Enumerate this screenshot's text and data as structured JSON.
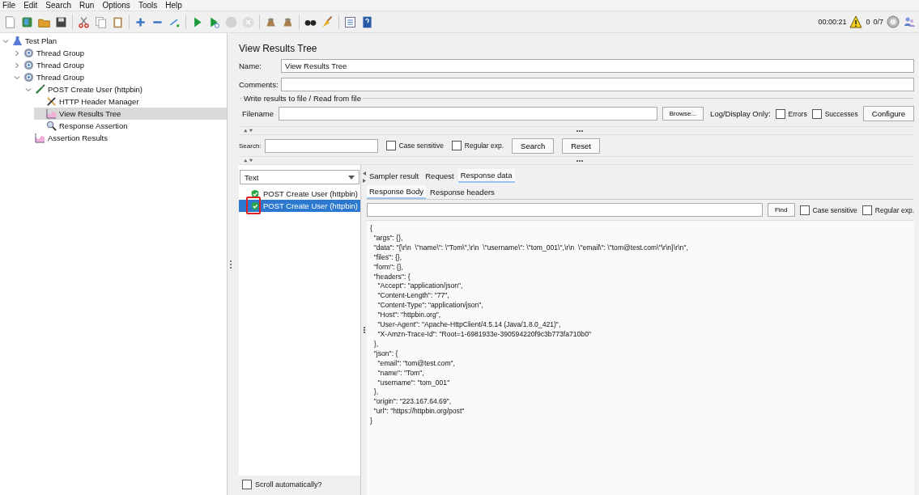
{
  "menu": [
    {
      "label": "File"
    },
    {
      "label": "Edit"
    },
    {
      "label": "Search"
    },
    {
      "label": "Run"
    },
    {
      "label": "Options"
    },
    {
      "label": "Tools"
    },
    {
      "label": "Help"
    }
  ],
  "toolbar": [
    {
      "kind": "new",
      "disabled": false
    },
    {
      "kind": "templates",
      "disabled": false
    },
    {
      "kind": "open",
      "disabled": false
    },
    {
      "kind": "save",
      "disabled": false
    },
    {
      "kind": "sep"
    },
    {
      "kind": "cut",
      "disabled": false
    },
    {
      "kind": "copy",
      "disabled": false
    },
    {
      "kind": "paste",
      "disabled": false
    },
    {
      "kind": "sep"
    },
    {
      "kind": "expand",
      "disabled": false
    },
    {
      "kind": "collapse",
      "disabled": false
    },
    {
      "kind": "toggle",
      "disabled": false
    },
    {
      "kind": "sep"
    },
    {
      "kind": "start",
      "disabled": false
    },
    {
      "kind": "start-no-pause",
      "disabled": false
    },
    {
      "kind": "stop",
      "disabled": true
    },
    {
      "kind": "shutdown",
      "disabled": true
    },
    {
      "kind": "sep"
    },
    {
      "kind": "clear",
      "disabled": false
    },
    {
      "kind": "clear-all",
      "disabled": false
    },
    {
      "kind": "sep"
    },
    {
      "kind": "search",
      "disabled": false
    },
    {
      "kind": "reset-search",
      "disabled": false
    },
    {
      "kind": "sep"
    },
    {
      "kind": "functions",
      "disabled": false
    },
    {
      "kind": "help",
      "disabled": false
    }
  ],
  "status": {
    "elapsed": "00:00:21",
    "warnings": "0",
    "threads": "0/7"
  },
  "tree": [
    {
      "label": "Test Plan",
      "kind": "plan",
      "expanded": true,
      "selected": false,
      "children": [
        {
          "label": "Thread Group",
          "kind": "thread",
          "expanded": false,
          "selected": false
        },
        {
          "label": "Thread Group",
          "kind": "thread",
          "expanded": false,
          "selected": false
        },
        {
          "label": "Thread Group",
          "kind": "thread",
          "expanded": true,
          "selected": false,
          "children": [
            {
              "label": "POST Create User (httpbin)",
              "kind": "sampler",
              "expanded": true,
              "selected": false,
              "children": [
                {
                  "label": "HTTP Header Manager",
                  "kind": "config",
                  "selected": false
                },
                {
                  "label": "View Results Tree",
                  "kind": "listener",
                  "selected": true
                },
                {
                  "label": "Response Assertion",
                  "kind": "assertion",
                  "selected": false
                }
              ]
            },
            {
              "label": "Assertion Results",
              "kind": "listener",
              "selected": false
            }
          ]
        }
      ]
    }
  ],
  "panel": {
    "title": "View Results Tree",
    "name_label": "Name:",
    "name_value": "View Results Tree",
    "comments_label": "Comments:",
    "file_group": "Write results to file / Read from file",
    "filename_label": "Filename",
    "browse": "Browse...",
    "log_display": "Log/Display Only:",
    "errors": {
      "label": "Errors",
      "checked": false
    },
    "successes": {
      "label": "Successes",
      "checked": false
    },
    "configure": "Configure",
    "search_label": "Search:",
    "case_sensitive": {
      "label": "Case sensitive",
      "checked": false
    },
    "regex": {
      "label": "Regular exp.",
      "checked": false
    },
    "search_button": "Search",
    "reset_button": "Reset"
  },
  "results": {
    "renderer": "Text",
    "items": [
      {
        "label": "POST Create User (httpbin)",
        "kind": "success",
        "selected": false,
        "highlighted": false
      },
      {
        "label": "POST Create User (httpbin)",
        "kind": "success",
        "selected": true,
        "highlighted": true
      }
    ],
    "scroll_auto": {
      "label": "Scroll automatically?",
      "checked": false
    }
  },
  "tabs": [
    {
      "label": "Sampler result",
      "selected": false
    },
    {
      "label": "Request",
      "selected": false
    },
    {
      "label": "Response data",
      "selected": true
    }
  ],
  "subtabs": [
    {
      "label": "Response Body",
      "selected": true
    },
    {
      "label": "Response headers",
      "selected": false
    }
  ],
  "find": {
    "button": "Find",
    "case_sensitive": {
      "label": "Case sensitive",
      "checked": false
    },
    "regex": {
      "label": "Regular exp.",
      "checked": false
    }
  },
  "response_body": "{\n  \"args\": {},\n  \"data\": \"{\\r\\n  \\\"name\\\": \\\"Tom\\\",\\r\\n  \\\"username\\\": \\\"tom_001\\\",\\r\\n  \\\"email\\\": \\\"tom@test.com\\\"\\r\\n}\\r\\n\",\n  \"files\": {},\n  \"form\": {},\n  \"headers\": {\n    \"Accept\": \"application/json\",\n    \"Content-Length\": \"77\",\n    \"Content-Type\": \"application/json\",\n    \"Host\": \"httpbin.org\",\n    \"User-Agent\": \"Apache-HttpClient/4.5.14 (Java/1.8.0_421)\",\n    \"X-Amzn-Trace-Id\": \"Root=1-6981933e-390594220f9c3b773fa710b0\"\n  },\n  \"json\": {\n    \"email\": \"tom@test.com\",\n    \"name\": \"Tom\",\n    \"username\": \"tom_001\"\n  },\n  \"origin\": \"223.167.64.69\",\n  \"url\": \"https://httpbin.org/post\"\n}"
}
